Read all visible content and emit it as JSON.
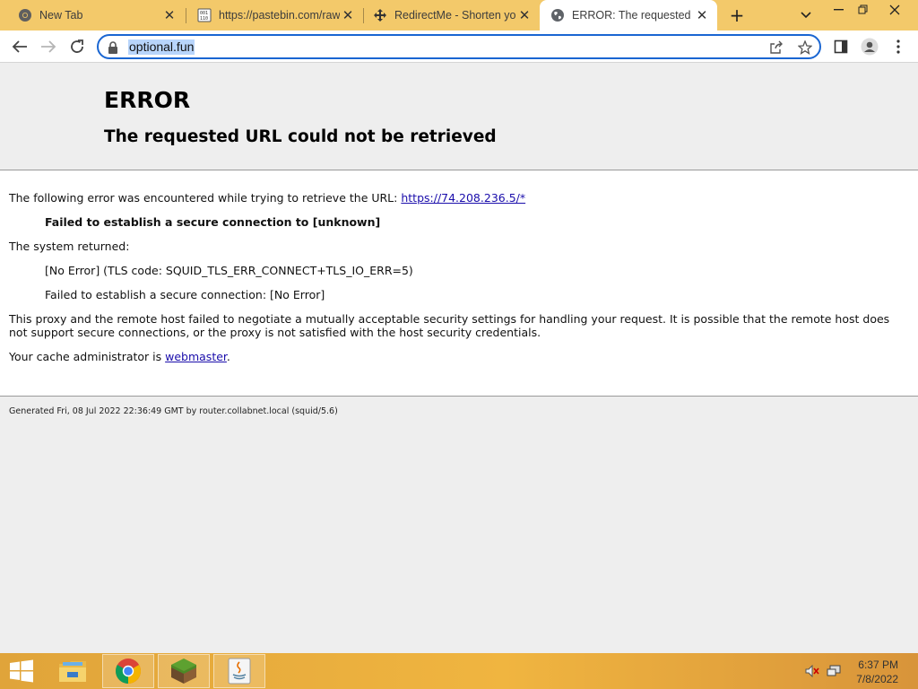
{
  "browser": {
    "tabs": [
      {
        "title": "New Tab",
        "favicon": "chrome-icon"
      },
      {
        "title": "https://pastebin.com/raw",
        "favicon": "pastebin-icon"
      },
      {
        "title": "RedirectMe - Shorten yo",
        "favicon": "redirectme-icon"
      },
      {
        "title": "ERROR: The requested U",
        "favicon": "globe-icon",
        "active": true
      }
    ],
    "address": "optional.fun",
    "colors": {
      "tab_strip": "#f3c96a",
      "omnibox_border": "#1a66d2",
      "selection": "#b8d5fb"
    }
  },
  "error_page": {
    "heading": "ERROR",
    "subheading": "The requested URL could not be retrieved",
    "intro": "The following error was encountered while trying to retrieve the URL: ",
    "url": "https://74.208.236.5/*",
    "failure": "Failed to establish a secure connection to [unknown]",
    "system_returned": "The system returned:",
    "tls_error": "[No Error] (TLS code: SQUID_TLS_ERR_CONNECT+TLS_IO_ERR=5)",
    "secure_fail": "Failed to establish a secure connection: [No Error]",
    "explanation": "This proxy and the remote host failed to negotiate a mutually acceptable security settings for handling your request. It is possible that the remote host does not support secure connections, or the proxy is not satisfied with the host security credentials.",
    "admin_prefix": "Your cache administrator is ",
    "admin_link": "webmaster",
    "admin_suffix": ".",
    "footer": "Generated Fri, 08 Jul 2022 22:36:49 GMT by router.collabnet.local (squid/5.6)"
  },
  "taskbar": {
    "time": "6:37 PM",
    "date": "7/8/2022",
    "apps": [
      "windows-start-icon",
      "file-explorer-icon",
      "chrome-icon",
      "minecraft-icon",
      "java-icon"
    ]
  }
}
